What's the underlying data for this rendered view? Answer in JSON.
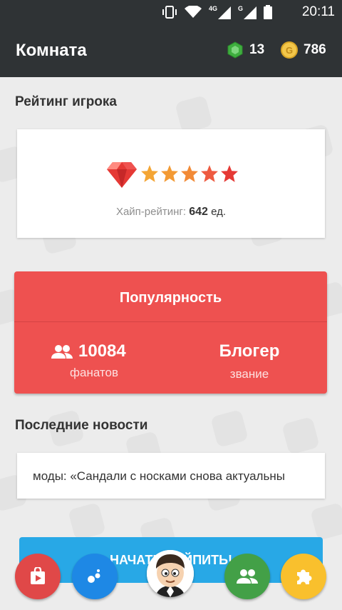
{
  "status_bar": {
    "time": "20:11",
    "net1": "4G",
    "net2": "G"
  },
  "app_bar": {
    "title": "Комната",
    "gems": "13",
    "coins": "786",
    "coin_letter": "G"
  },
  "rating": {
    "section_title": "Рейтинг игрока",
    "stars": 5,
    "label": "Хайп-рейтинг:",
    "value": "642",
    "unit": "ед."
  },
  "popularity": {
    "title": "Популярность",
    "fans_value": "10084",
    "fans_label": "фанатов",
    "rank_value": "Блогер",
    "rank_label": "звание"
  },
  "news": {
    "section_title": "Последние новости",
    "text": "моды: «Сандали с носками снова актуальны"
  },
  "start_button": {
    "label": "НАЧАТЬ ХАЙПИТЬ!"
  },
  "colors": {
    "accent_red": "#ee5150",
    "app_bar": "#2f3335",
    "start_blue": "#28a8e6"
  },
  "bottom_nav": [
    {
      "name": "shop-bag-icon",
      "color": "#e04848"
    },
    {
      "name": "bubbles-icon",
      "color": "#1e88e5"
    },
    {
      "name": "people-icon",
      "color": "#43a047"
    },
    {
      "name": "puzzle-icon",
      "color": "#f9c02d"
    }
  ]
}
